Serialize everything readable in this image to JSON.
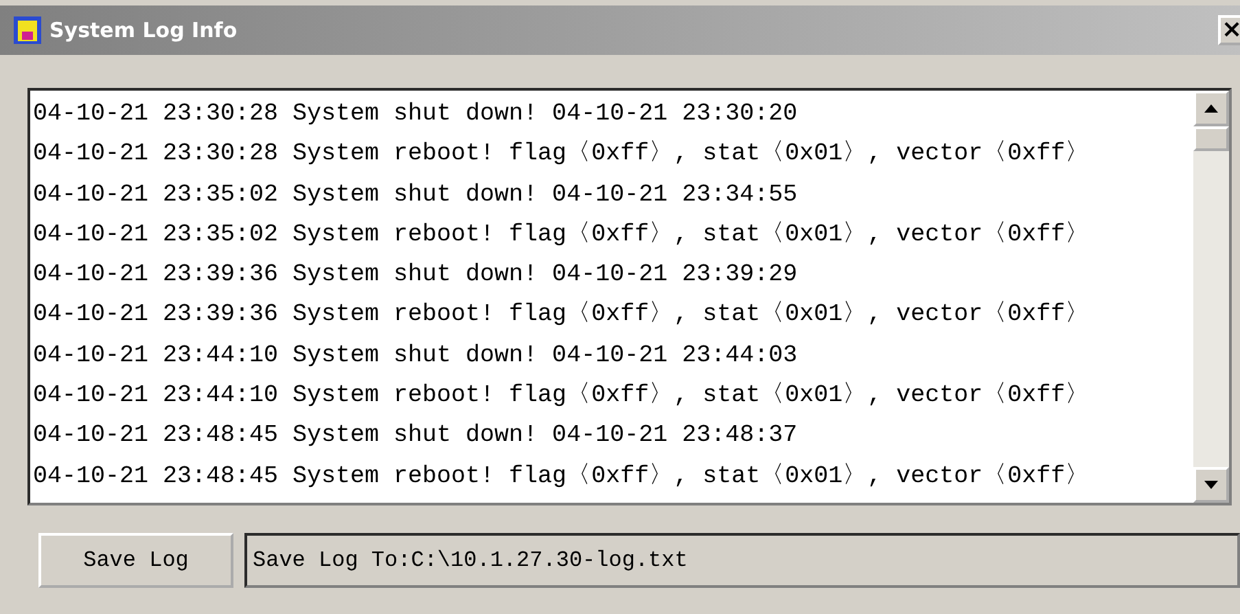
{
  "window": {
    "title": "System Log Info",
    "close": "×"
  },
  "log": {
    "lines": [
      "04-10-21 23:30:28 System shut down! 04-10-21 23:30:20",
      "04-10-21 23:30:28 System reboot! flag〈0xff〉, stat〈0x01〉, vector〈0xff〉",
      "04-10-21 23:35:02 System shut down! 04-10-21 23:34:55",
      "04-10-21 23:35:02 System reboot! flag〈0xff〉, stat〈0x01〉, vector〈0xff〉",
      "04-10-21 23:39:36 System shut down! 04-10-21 23:39:29",
      "04-10-21 23:39:36 System reboot! flag〈0xff〉, stat〈0x01〉, vector〈0xff〉",
      "04-10-21 23:44:10 System shut down! 04-10-21 23:44:03",
      "04-10-21 23:44:10 System reboot! flag〈0xff〉, stat〈0x01〉, vector〈0xff〉",
      "04-10-21 23:48:45 System shut down! 04-10-21 23:48:37",
      "04-10-21 23:48:45 System reboot! flag〈0xff〉, stat〈0x01〉, vector〈0xff〉"
    ]
  },
  "save_button": "Save Log",
  "path_field": {
    "value": "Save Log To:C:\\10.1.27.30-log.txt"
  }
}
